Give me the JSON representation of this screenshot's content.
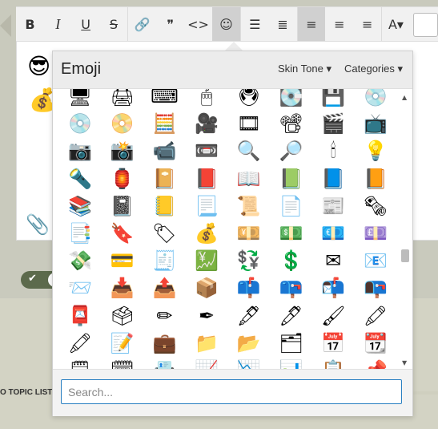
{
  "toolbar": {
    "buttons": [
      {
        "name": "bold-button",
        "glyph": "B",
        "cls": "bold"
      },
      {
        "name": "italic-button",
        "glyph": "I",
        "cls": "italic"
      },
      {
        "name": "underline-button",
        "glyph": "U",
        "cls": "underline"
      },
      {
        "name": "strikethrough-button",
        "glyph": "S",
        "cls": "strike"
      },
      {
        "sep": true
      },
      {
        "name": "link-icon",
        "glyph": "🔗",
        "cls": ""
      },
      {
        "name": "quote-icon",
        "glyph": "❞",
        "cls": ""
      },
      {
        "name": "code-icon",
        "glyph": "<>",
        "cls": ""
      },
      {
        "name": "emoji-icon",
        "glyph": "☺",
        "cls": "active"
      },
      {
        "sep": true
      },
      {
        "name": "bullet-list-icon",
        "glyph": "☰",
        "cls": ""
      },
      {
        "name": "numbered-list-icon",
        "glyph": "≣",
        "cls": ""
      },
      {
        "sep": true
      },
      {
        "name": "align-left-icon",
        "glyph": "≡",
        "cls": "active"
      },
      {
        "name": "align-center-icon",
        "glyph": "≡",
        "cls": ""
      },
      {
        "name": "align-right-icon",
        "glyph": "≡",
        "cls": ""
      },
      {
        "sep": true
      },
      {
        "name": "text-color-icon",
        "glyph": "A▾",
        "cls": ""
      }
    ]
  },
  "editor_emojis": [
    "😎",
    "💰"
  ],
  "attachment_icon": "📎",
  "topic_text": "O TOPIC LISTI",
  "emoji_popup": {
    "title": "Emoji",
    "skin_tone_label": "Skin Tone",
    "categories_label": "Categories",
    "search_placeholder": "Search...",
    "emoji_grid": [
      [
        "🖥",
        "🖨",
        "⌨",
        "🖱",
        "🖲",
        "💽",
        "💾",
        "💿",
        "📺"
      ],
      [
        "💿",
        "📀",
        "🧮",
        "🎥",
        "🎞",
        "📽",
        "🎬",
        "📺",
        "📷"
      ],
      [
        "📷",
        "📸",
        "📹",
        "📼",
        "🔍",
        "🔎",
        "🕯",
        "💡",
        "🔦"
      ],
      [
        "🔦",
        "🏮",
        "📔",
        "📕",
        "📖",
        "📗",
        "📘",
        "📙",
        "📚"
      ],
      [
        "📚",
        "📓",
        "📒",
        "📃",
        "📜",
        "📄",
        "📰",
        "🗞",
        "📑"
      ],
      [
        "📑",
        "🔖",
        "🏷",
        "💰",
        "💴",
        "💵",
        "💶",
        "💷",
        "💸"
      ],
      [
        "💸",
        "💳",
        "🧾",
        "💹",
        "💱",
        "💲",
        "✉",
        "📧",
        "📨"
      ],
      [
        "📨",
        "📥",
        "📤",
        "📦",
        "📫",
        "📪",
        "📬",
        "📭",
        "📮"
      ],
      [
        "📮",
        "🗳",
        "✏",
        "✒",
        "🖋",
        "🖊",
        "🖌",
        "🖍",
        "📝"
      ],
      [
        "🖍",
        "📝",
        "💼",
        "📁",
        "📂",
        "🗂",
        "📅",
        "📆",
        "🗒"
      ],
      [
        "🗒",
        "🗓",
        "📇",
        "📈",
        "📉",
        "📊",
        "📋",
        "📌",
        "📍"
      ]
    ]
  }
}
